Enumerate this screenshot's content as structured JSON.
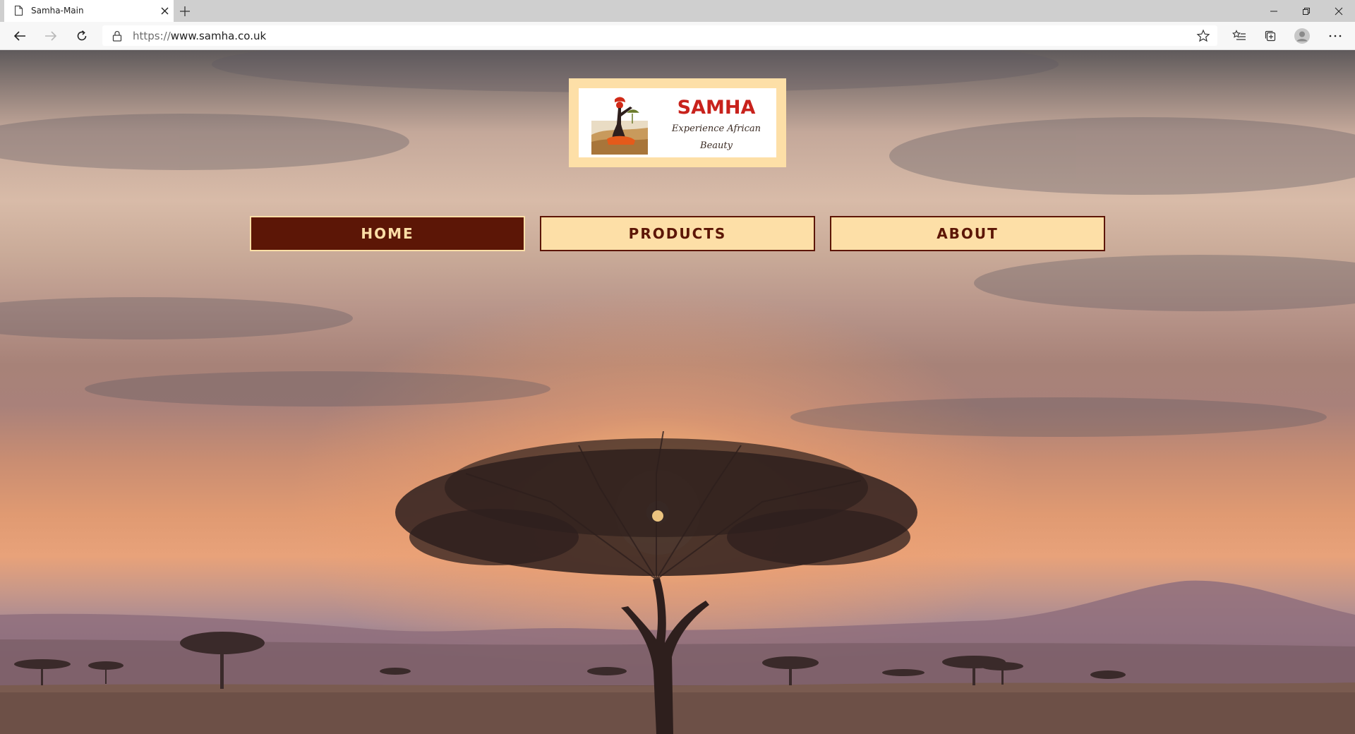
{
  "browser": {
    "tab_title": "Samha-Main",
    "url_scheme": "https://",
    "url_host": "www.samha.co.uk"
  },
  "icons": {
    "tab": "page-icon",
    "tab_close": "close-icon",
    "new_tab": "plus-icon",
    "minimize": "minimize-icon",
    "restore": "restore-icon",
    "close_window": "close-icon",
    "back": "arrow-left-icon",
    "forward": "arrow-right-icon",
    "refresh": "refresh-icon",
    "lock": "lock-icon",
    "favorite": "star-icon",
    "favorites_list": "favorites-list-icon",
    "collections": "collections-icon",
    "profile": "profile-icon",
    "more": "ellipsis-icon"
  },
  "logo": {
    "name": "SAMHA",
    "tagline_line1": "Experience African",
    "tagline_line2": "Beauty"
  },
  "nav": {
    "items": [
      {
        "label": "HOME",
        "active": true
      },
      {
        "label": "PRODUCTS",
        "active": false
      },
      {
        "label": "ABOUT",
        "active": false
      }
    ]
  },
  "colors": {
    "brand_dark": "#5c1606",
    "brand_light": "#fddfa7",
    "logo_red": "#c8221c"
  }
}
